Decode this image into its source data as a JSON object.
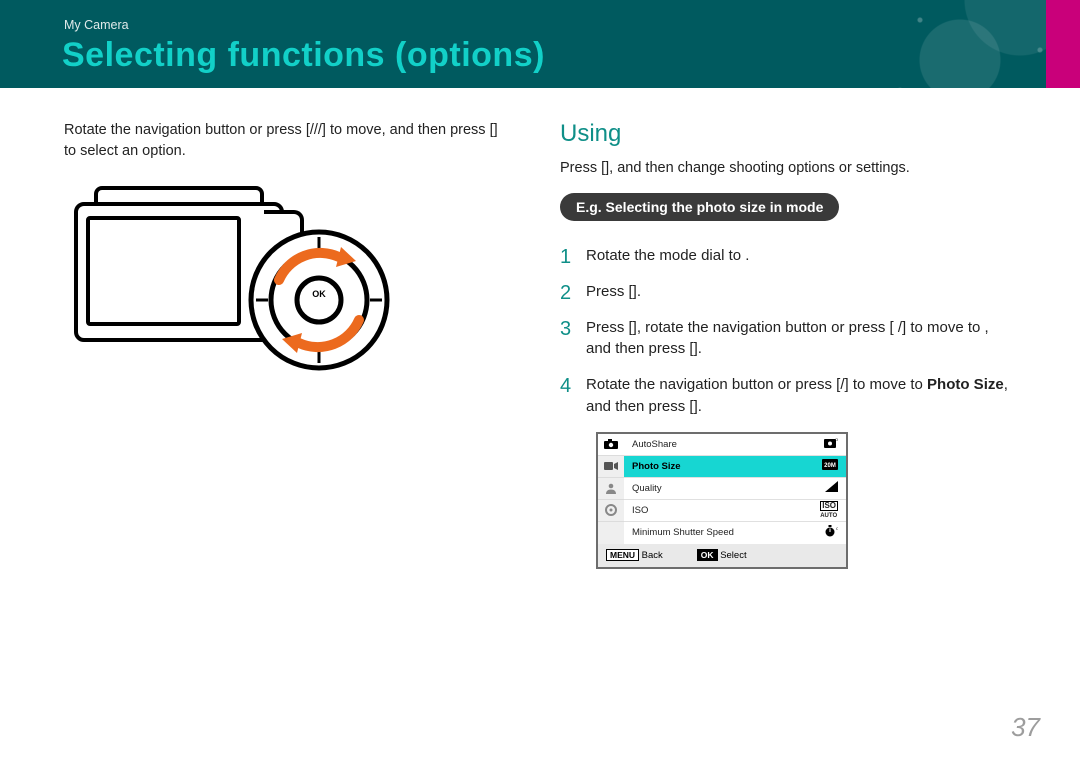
{
  "breadcrumb": "My Camera",
  "pageTitle": "Selecting functions (options)",
  "left": {
    "intro": "Rotate the navigation button or press [///] to move, and then press [] to select an option."
  },
  "right": {
    "heading": "Using",
    "subIntro": "Press [], and then change shooting options or settings.",
    "pill": "E.g. Selecting the photo size in  mode",
    "steps": {
      "s1": "Rotate the mode dial to .",
      "s2": "Press [].",
      "s3": "Press [], rotate the navigation button or press [   /] to move to , and then press [].",
      "s4_a": "Rotate the navigation button or press [/] to move to ",
      "s4_b": "Photo Size",
      "s4_c": ", and then press []."
    }
  },
  "lcd": {
    "rows": [
      {
        "label": "AutoShare",
        "valueIcon": "autoshare-off-icon"
      },
      {
        "label": "Photo Size",
        "valueIcon": "size-20m-icon",
        "highlight": true
      },
      {
        "label": "Quality",
        "valueIcon": "quality-icon"
      },
      {
        "label": "ISO",
        "valueIcon": "iso-auto-icon"
      },
      {
        "label": "Minimum Shutter Speed",
        "valueIcon": "mss-icon"
      }
    ],
    "footer": {
      "backKey": "MENU",
      "backLabel": "Back",
      "okKey": "OK",
      "okLabel": "Select"
    }
  },
  "pageNumber": "37"
}
